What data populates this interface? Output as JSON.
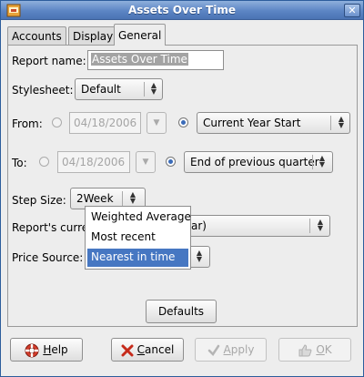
{
  "window": {
    "title": "Assets Over Time",
    "close_glyph": "✕"
  },
  "tabs": [
    {
      "label": "Accounts"
    },
    {
      "label": "Display"
    },
    {
      "label": "General"
    }
  ],
  "general": {
    "report_name_label": "Report name:",
    "report_name_value": "Assets Over Time",
    "stylesheet_label": "Stylesheet:",
    "stylesheet_value": "Default",
    "from_label": "From:",
    "from_date": "04/18/2006",
    "from_relative": "Current Year Start",
    "to_label": "To:",
    "to_date": "04/18/2006",
    "to_relative": "End of previous quarter",
    "step_size_label": "Step Size:",
    "step_size_value": "2Week",
    "currency_label": "Report's curren",
    "currency_value_tail": "ar)",
    "price_source_label": "Price Source:",
    "defaults_button": "Defaults"
  },
  "price_source_menu": {
    "options": [
      "Weighted Average",
      "Most recent",
      "Nearest in time"
    ],
    "selected": "Nearest in time"
  },
  "footer": {
    "help": {
      "prefix": "",
      "mnemonic": "H",
      "rest": "elp"
    },
    "cancel": {
      "mnemonic": "C",
      "rest": "ancel"
    },
    "apply": {
      "mnemonic": "A",
      "rest": "pply"
    },
    "ok": {
      "mnemonic": "O",
      "rest": "K"
    }
  },
  "colors": {
    "titlebar": "#5c85c4",
    "menu_highlight": "#4677c2"
  }
}
